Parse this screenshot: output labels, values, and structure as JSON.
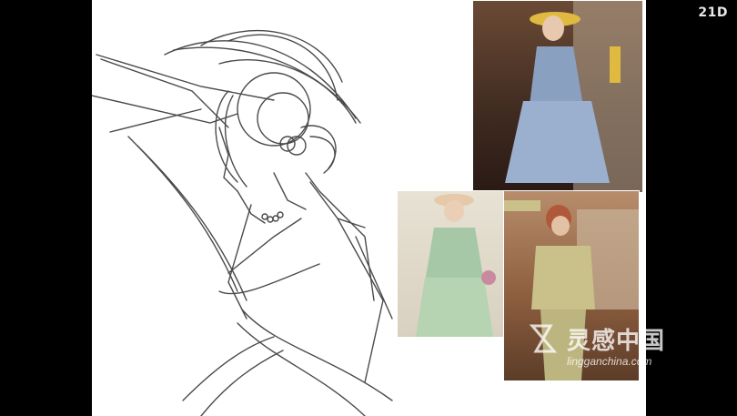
{
  "logo": {
    "text": "21D"
  },
  "watermark": {
    "brand": "灵感中国",
    "url": "lingganchina.com"
  },
  "references": [
    {
      "name": "woman in blue striped dress with yellow hat"
    },
    {
      "name": "woman in green floral dress with straw hat"
    },
    {
      "name": "woman in olive suit by vintage car"
    }
  ],
  "colors": {
    "background": "#000000",
    "canvas": "#ffffff",
    "sketch_line": "#2a2a2a"
  }
}
